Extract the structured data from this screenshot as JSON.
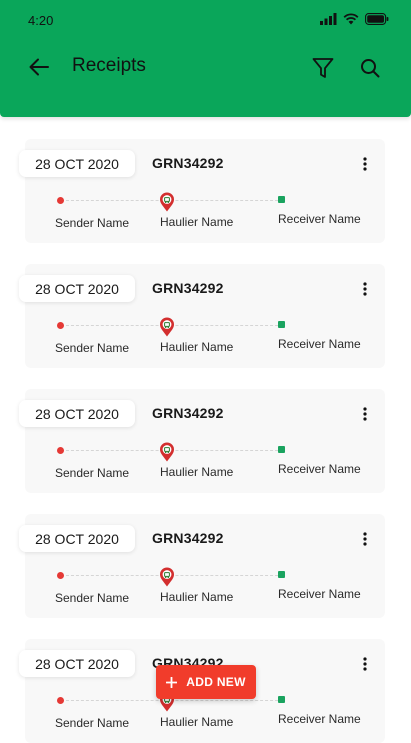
{
  "status_bar": {
    "time": "4:20"
  },
  "header": {
    "title": "Receipts"
  },
  "colors": {
    "primary": "#0aa65a",
    "accent": "#f13c2b",
    "sender_dot": "#e53935",
    "receiver_dot": "#1aa35f"
  },
  "receipts": [
    {
      "date": "28 OCT 2020",
      "grn": "GRN34292",
      "sender": "Sender Name",
      "haulier": "Haulier Name",
      "receiver": "Receiver Name"
    },
    {
      "date": "28 OCT 2020",
      "grn": "GRN34292",
      "sender": "Sender Name",
      "haulier": "Haulier Name",
      "receiver": "Receiver Name"
    },
    {
      "date": "28 OCT 2020",
      "grn": "GRN34292",
      "sender": "Sender Name",
      "haulier": "Haulier Name",
      "receiver": "Receiver Name"
    },
    {
      "date": "28 OCT 2020",
      "grn": "GRN34292",
      "sender": "Sender Name",
      "haulier": "Haulier Name",
      "receiver": "Receiver Name"
    },
    {
      "date": "28 OCT 2020",
      "grn": "GRN34292",
      "sender": "Sender Name",
      "haulier": "Haulier Name",
      "receiver": "Receiver Name"
    }
  ],
  "fab": {
    "label": "ADD NEW",
    "icon": "plus-icon"
  },
  "icons": {
    "back": "arrow-left-icon",
    "filter": "filter-icon",
    "search": "search-icon",
    "more": "more-vert-icon",
    "haulier": "map-pin-icon"
  }
}
